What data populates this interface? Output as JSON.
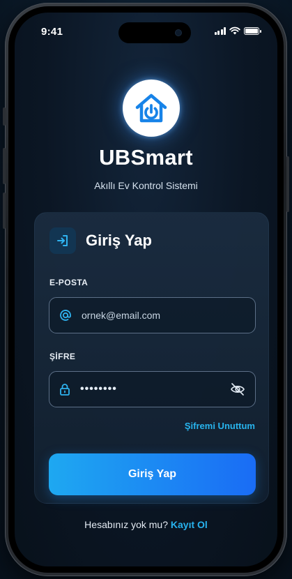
{
  "status_bar": {
    "time": "9:41"
  },
  "app": {
    "name": "UBSmart",
    "subtitle": "Akıllı Ev Kontrol Sistemi",
    "logo_icon": "house-power-icon"
  },
  "login_card": {
    "title": "Giriş Yap",
    "header_icon": "enter-icon",
    "email": {
      "label": "E-POSTA",
      "placeholder": "ornek@email.com",
      "icon": "at-icon"
    },
    "password": {
      "label": "ŞİFRE",
      "value": "••••••••",
      "icon": "lock-icon",
      "toggle_icon": "eye-off-icon"
    },
    "forgot_link": "Şifremi Unuttum",
    "submit_label": "Giriş Yap"
  },
  "footer": {
    "prompt": "Hesabınız yok mu?",
    "register_link": "Kayıt Ol"
  },
  "colors": {
    "accent": "#28b4ee",
    "button_start": "#1ea8f1",
    "button_end": "#1a6cf5",
    "card_bg": "#1b2c40",
    "screen_bg": "#0b1624"
  }
}
